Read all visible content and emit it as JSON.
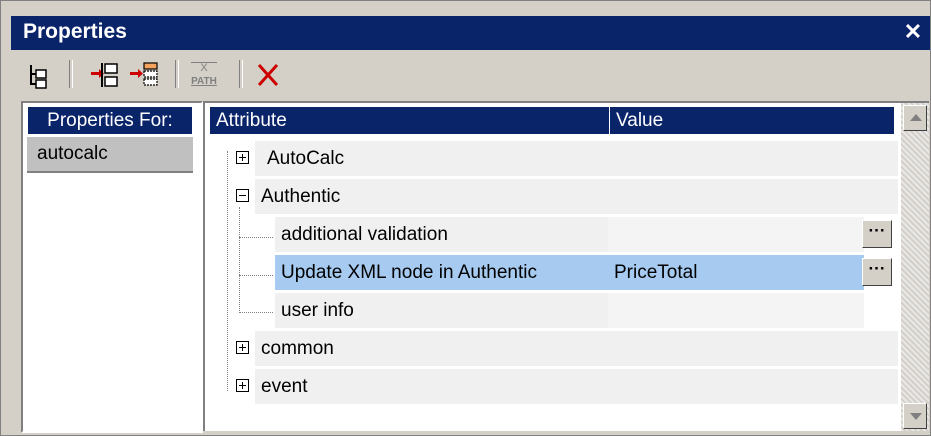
{
  "window": {
    "title": "Properties",
    "close_label": "✕"
  },
  "toolbar": {
    "buttons": [
      {
        "name": "element-tree-icon"
      },
      {
        "name": "insert-before-icon"
      },
      {
        "name": "append-icon"
      },
      {
        "name": "xpath-icon",
        "label_top": "X",
        "label_bottom": "PATH"
      },
      {
        "name": "delete-icon"
      }
    ]
  },
  "left_panel": {
    "header": "Properties For:",
    "items": [
      "autocalc"
    ]
  },
  "properties": {
    "headers": {
      "attribute": "Attribute",
      "value": "Value"
    },
    "rows": [
      {
        "label": "AutoCalc",
        "expander": "plus",
        "value": ""
      },
      {
        "label": "Authentic",
        "expander": "minus",
        "value": ""
      },
      {
        "label": "additional validation",
        "value": "",
        "has_button": true
      },
      {
        "label": "Update XML node in Authentic",
        "value": "PriceTotal",
        "has_button": true,
        "selected": true
      },
      {
        "label": "user info",
        "value": ""
      },
      {
        "label": "common",
        "expander": "plus",
        "value": ""
      },
      {
        "label": "event",
        "expander": "plus",
        "value": ""
      }
    ],
    "button_label": "···"
  },
  "colors": {
    "title_bg": "#0a246a",
    "selection": "#a6caf0",
    "window_bg": "#d4d0c8"
  }
}
